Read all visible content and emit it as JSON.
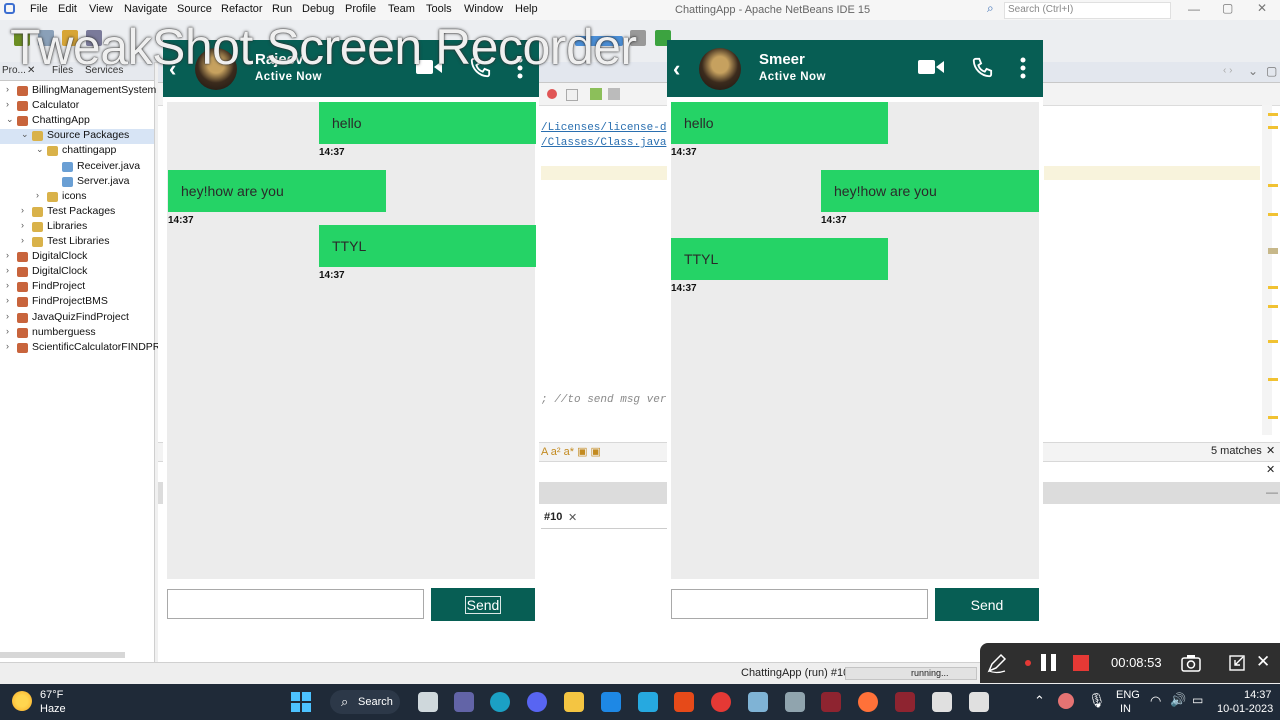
{
  "watermark": "TweakShot Screen Recorder",
  "ide": {
    "title": "ChattingApp - Apache NetBeans IDE 15",
    "menu": [
      "File",
      "Edit",
      "View",
      "Navigate",
      "Source",
      "Refactor",
      "Run",
      "Debug",
      "Profile",
      "Team",
      "Tools",
      "Window",
      "Help"
    ],
    "search_placeholder": "Search (Ctrl+I)",
    "project_tabs": [
      "Pro...",
      "Files",
      "Services"
    ],
    "tree": [
      {
        "label": "BillingManagementSystem",
        "level": 0,
        "twisty": "›",
        "icon": "project"
      },
      {
        "label": "Calculator",
        "level": 0,
        "twisty": "›",
        "icon": "project"
      },
      {
        "label": "ChattingApp",
        "level": 0,
        "twisty": "⌄",
        "icon": "project"
      },
      {
        "label": "Source Packages",
        "level": 1,
        "twisty": "⌄",
        "icon": "folder",
        "selected": true
      },
      {
        "label": "chattingapp",
        "level": 2,
        "twisty": "⌄",
        "icon": "package"
      },
      {
        "label": "Receiver.java",
        "level": 3,
        "twisty": "",
        "icon": "java"
      },
      {
        "label": "Server.java",
        "level": 3,
        "twisty": "",
        "icon": "java"
      },
      {
        "label": "icons",
        "level": 2,
        "twisty": "›",
        "icon": "package"
      },
      {
        "label": "Test Packages",
        "level": 1,
        "twisty": "›",
        "icon": "folder"
      },
      {
        "label": "Libraries",
        "level": 1,
        "twisty": "›",
        "icon": "folder"
      },
      {
        "label": "Test Libraries",
        "level": 1,
        "twisty": "›",
        "icon": "folder"
      },
      {
        "label": "DigitalClock",
        "level": 0,
        "twisty": "›",
        "icon": "project"
      },
      {
        "label": "DigitalClock",
        "level": 0,
        "twisty": "›",
        "icon": "project"
      },
      {
        "label": "FindProject",
        "level": 0,
        "twisty": "›",
        "icon": "project"
      },
      {
        "label": "FindProjectBMS",
        "level": 0,
        "twisty": "›",
        "icon": "project"
      },
      {
        "label": "JavaQuizFindProject",
        "level": 0,
        "twisty": "›",
        "icon": "project"
      },
      {
        "label": "numberguess",
        "level": 0,
        "twisty": "›",
        "icon": "project"
      },
      {
        "label": "ScientificCalculatorFINDPR",
        "level": 0,
        "twisty": "›",
        "icon": "project"
      }
    ],
    "code_lines": {
      "license": "/Licenses/license-d",
      "classes": "/Classes/Class.java",
      "comment": "; //to send msg ver"
    },
    "find_matches": "5 matches",
    "output_tab": "#10",
    "status_run": "ChattingApp (run) #10",
    "status_state": "running..."
  },
  "chats": [
    {
      "name": "Rajeev",
      "status": "Active Now",
      "messages": [
        {
          "text": "hello",
          "time": "14:37",
          "side": "right"
        },
        {
          "text": "hey!how are you",
          "time": "14:37",
          "side": "left"
        },
        {
          "text": "TTYL",
          "time": "14:37",
          "side": "right"
        }
      ],
      "input_value": "",
      "send_label": "Send"
    },
    {
      "name": "Smeer",
      "status": "Active Now",
      "messages": [
        {
          "text": "hello",
          "time": "14:37",
          "side": "left"
        },
        {
          "text": "hey!how are you",
          "time": "14:37",
          "side": "right"
        },
        {
          "text": "TTYL",
          "time": "14:37",
          "side": "left"
        }
      ],
      "input_value": "",
      "send_label": "Send"
    }
  ],
  "recorder": {
    "time": "00:08:53"
  },
  "taskbar": {
    "weather_temp": "67°F",
    "weather_desc": "Haze",
    "search_label": "Search",
    "lang_top": "ENG",
    "lang_bottom": "IN",
    "clock_time": "14:37",
    "clock_date": "10-01-2023"
  },
  "colors": {
    "chat_header": "#075e54",
    "bubble": "#25d366",
    "chat_pane": "#ececec"
  }
}
